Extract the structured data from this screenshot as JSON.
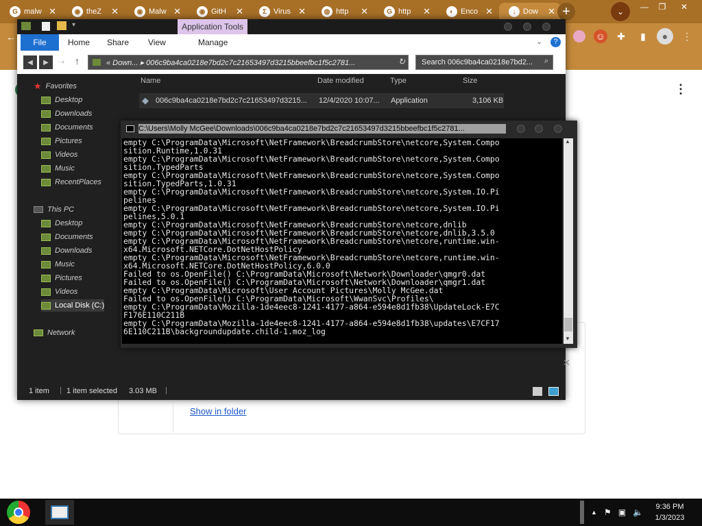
{
  "chrome": {
    "tabs": [
      {
        "label": "malw",
        "icon": "google-icon"
      },
      {
        "label": "theZ",
        "icon": "github-icon"
      },
      {
        "label": "Malw",
        "icon": "github-icon"
      },
      {
        "label": "GitH",
        "icon": "github-icon"
      },
      {
        "label": "Virus",
        "icon": "virustotal-icon"
      },
      {
        "label": "http",
        "icon": "globe-icon"
      },
      {
        "label": "http",
        "icon": "google-icon"
      },
      {
        "label": "Enco",
        "icon": "search-icon"
      },
      {
        "label": "Dow",
        "icon": "download-icon"
      }
    ],
    "new_tab": "+",
    "show_in_folder": "Show in folder",
    "theme_color": "#c58a3c"
  },
  "explorer": {
    "app_tools": "Application Tools",
    "ribbon": {
      "file": "File",
      "home": "Home",
      "share": "Share",
      "view": "View",
      "manage": "Manage"
    },
    "address": "« Down... ▸ 006c9ba4ca0218e7bd2c7c21653497d3215bbeefbc1f5c2781...",
    "search_placeholder": "Search 006c9ba4ca0218e7bd2...",
    "nav": {
      "favorites": "Favorites",
      "fav_items": [
        "Desktop",
        "Downloads",
        "Documents",
        "Pictures",
        "Videos",
        "Music",
        "RecentPlaces"
      ],
      "this_pc": "This PC",
      "pc_items": [
        "Desktop",
        "Documents",
        "Downloads",
        "Music",
        "Pictures",
        "Videos",
        "Local Disk (C:)"
      ],
      "network": "Network"
    },
    "columns": {
      "name": "Name",
      "date": "Date modified",
      "type": "Type",
      "size": "Size"
    },
    "file": {
      "name": "006c9ba4ca0218e7bd2c7c21653497d3215...",
      "date": "12/4/2020 10:07...",
      "type": "Application",
      "size": "3,106 KB"
    },
    "status": {
      "count": "1 item",
      "selected": "1 item selected",
      "size": "3.03 MB"
    }
  },
  "console": {
    "title": "C:\\Users\\Molly McGee\\Downloads\\006c9ba4ca0218e7bd2c7c21653497d3215bbeefbc1f5c2781...",
    "lines": [
      "empty C:\\ProgramData\\Microsoft\\NetFramework\\BreadcrumbStore\\netcore,System.Compo",
      "sition.Runtime,1.0.31",
      "empty C:\\ProgramData\\Microsoft\\NetFramework\\BreadcrumbStore\\netcore,System.Compo",
      "sition.TypedParts",
      "empty C:\\ProgramData\\Microsoft\\NetFramework\\BreadcrumbStore\\netcore,System.Compo",
      "sition.TypedParts,1.0.31",
      "empty C:\\ProgramData\\Microsoft\\NetFramework\\BreadcrumbStore\\netcore,System.IO.Pi",
      "pelines",
      "empty C:\\ProgramData\\Microsoft\\NetFramework\\BreadcrumbStore\\netcore,System.IO.Pi",
      "pelines,5.0.1",
      "empty C:\\ProgramData\\Microsoft\\NetFramework\\BreadcrumbStore\\netcore,dnlib",
      "empty C:\\ProgramData\\Microsoft\\NetFramework\\BreadcrumbStore\\netcore,dnlib,3.5.0",
      "empty C:\\ProgramData\\Microsoft\\NetFramework\\BreadcrumbStore\\netcore,runtime.win-",
      "x64.Microsoft.NETCore.DotNetHostPolicy",
      "empty C:\\ProgramData\\Microsoft\\NetFramework\\BreadcrumbStore\\netcore,runtime.win-",
      "x64.Microsoft.NETCore.DotNetHostPolicy,6.0.0",
      "Failed to os.OpenFile() C:\\ProgramData\\Microsoft\\Network\\Downloader\\qmgr0.dat",
      "Failed to os.OpenFile() C:\\ProgramData\\Microsoft\\Network\\Downloader\\qmgr1.dat",
      "empty C:\\ProgramData\\Microsoft\\User Account Pictures\\Molly McGee.dat",
      "Failed to os.OpenFile() C:\\ProgramData\\Microsoft\\WwanSvc\\Profiles\\",
      "empty C:\\ProgramData\\Mozilla-1de4eec8-1241-4177-a864-e594e8d1fb38\\UpdateLock-E7C",
      "F176E110C211B",
      "empty C:\\ProgramData\\Mozilla-1de4eec8-1241-4177-a864-e594e8d1fb38\\updates\\E7CF17",
      "6E110C211B\\backgroundupdate.child-1.moz_log"
    ]
  },
  "taskbar": {
    "time": "9:36 PM",
    "date": "1/3/2023"
  }
}
